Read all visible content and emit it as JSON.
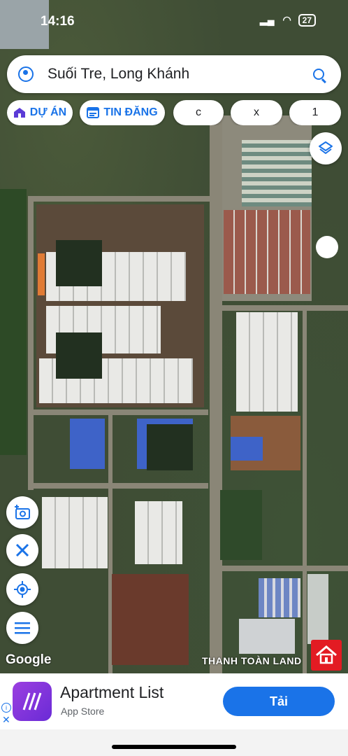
{
  "status_bar": {
    "time": "14:16",
    "battery": "27"
  },
  "search": {
    "query": "Suối Tre, Long Khánh"
  },
  "chips": [
    {
      "label": "DỰ ÁN",
      "icon": "house-icon"
    },
    {
      "label": "TIN ĐĂNG",
      "icon": "listing-icon"
    },
    {
      "label": "c"
    },
    {
      "label": "x"
    },
    {
      "label": "1"
    }
  ],
  "map": {
    "attribution": "Google",
    "watermark": "THANH TOÀN LAND"
  },
  "controls": [
    "layers-icon",
    "camera-plus-icon",
    "ruler-pencil-icon",
    "my-location-icon",
    "menu-icon"
  ],
  "ad": {
    "title": "Apartment List",
    "subtitle": "App Store",
    "button": "Tải"
  },
  "colors": {
    "accent": "#1a73e8",
    "brand_red": "#e31b23"
  }
}
